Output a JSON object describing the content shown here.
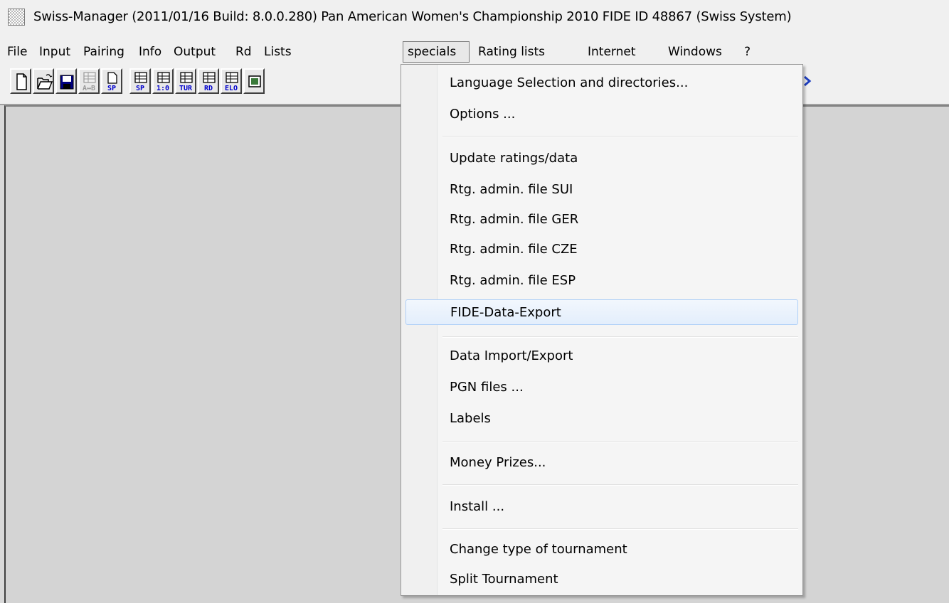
{
  "window": {
    "title": "Swiss-Manager (2011/01/16 Build: 8.0.0.280)  Pan American Women's Championship 2010  FIDE ID 48867  (Swiss System)"
  },
  "menubar": {
    "items": [
      "File",
      "Input",
      "Pairing",
      "Info",
      "Output",
      "Rd",
      "Lists",
      "specials",
      "Rating lists",
      "Internet",
      "Windows",
      "?"
    ],
    "active": "specials"
  },
  "toolbar": {
    "buttons": [
      {
        "icon": "new-document-icon",
        "label": ""
      },
      {
        "icon": "open-folder-icon",
        "label": ""
      },
      {
        "icon": "save-disk-icon",
        "label": ""
      },
      {
        "icon": "table-icon",
        "label": "A↔B",
        "disabled": true
      },
      {
        "icon": "document-icon",
        "label": "SP"
      },
      {
        "icon": "table-icon",
        "label": "SP"
      },
      {
        "icon": "table-icon",
        "label": "1:0"
      },
      {
        "icon": "table-icon",
        "label": "TUR"
      },
      {
        "icon": "table-icon",
        "label": "RD"
      },
      {
        "icon": "table-icon",
        "label": "ELO"
      },
      {
        "icon": "screen-icon",
        "label": ""
      }
    ]
  },
  "specials_menu": {
    "groups": [
      [
        "Language Selection and directories...",
        "Options ..."
      ],
      [
        "Update ratings/data",
        "Rtg. admin. file SUI",
        "Rtg. admin. file GER",
        "Rtg. admin. file CZE",
        "Rtg. admin. file ESP",
        "FIDE-Data-Export"
      ],
      [
        "Data Import/Export",
        "PGN files ...",
        "Labels"
      ],
      [
        "Money Prizes..."
      ],
      [
        "Install ..."
      ],
      [
        "Change type of tournament",
        "Split Tournament"
      ]
    ],
    "highlighted": "FIDE-Data-Export"
  },
  "colors": {
    "accent_highlight": "#aecff7",
    "toolbar_label_blue": "#0000cc"
  }
}
